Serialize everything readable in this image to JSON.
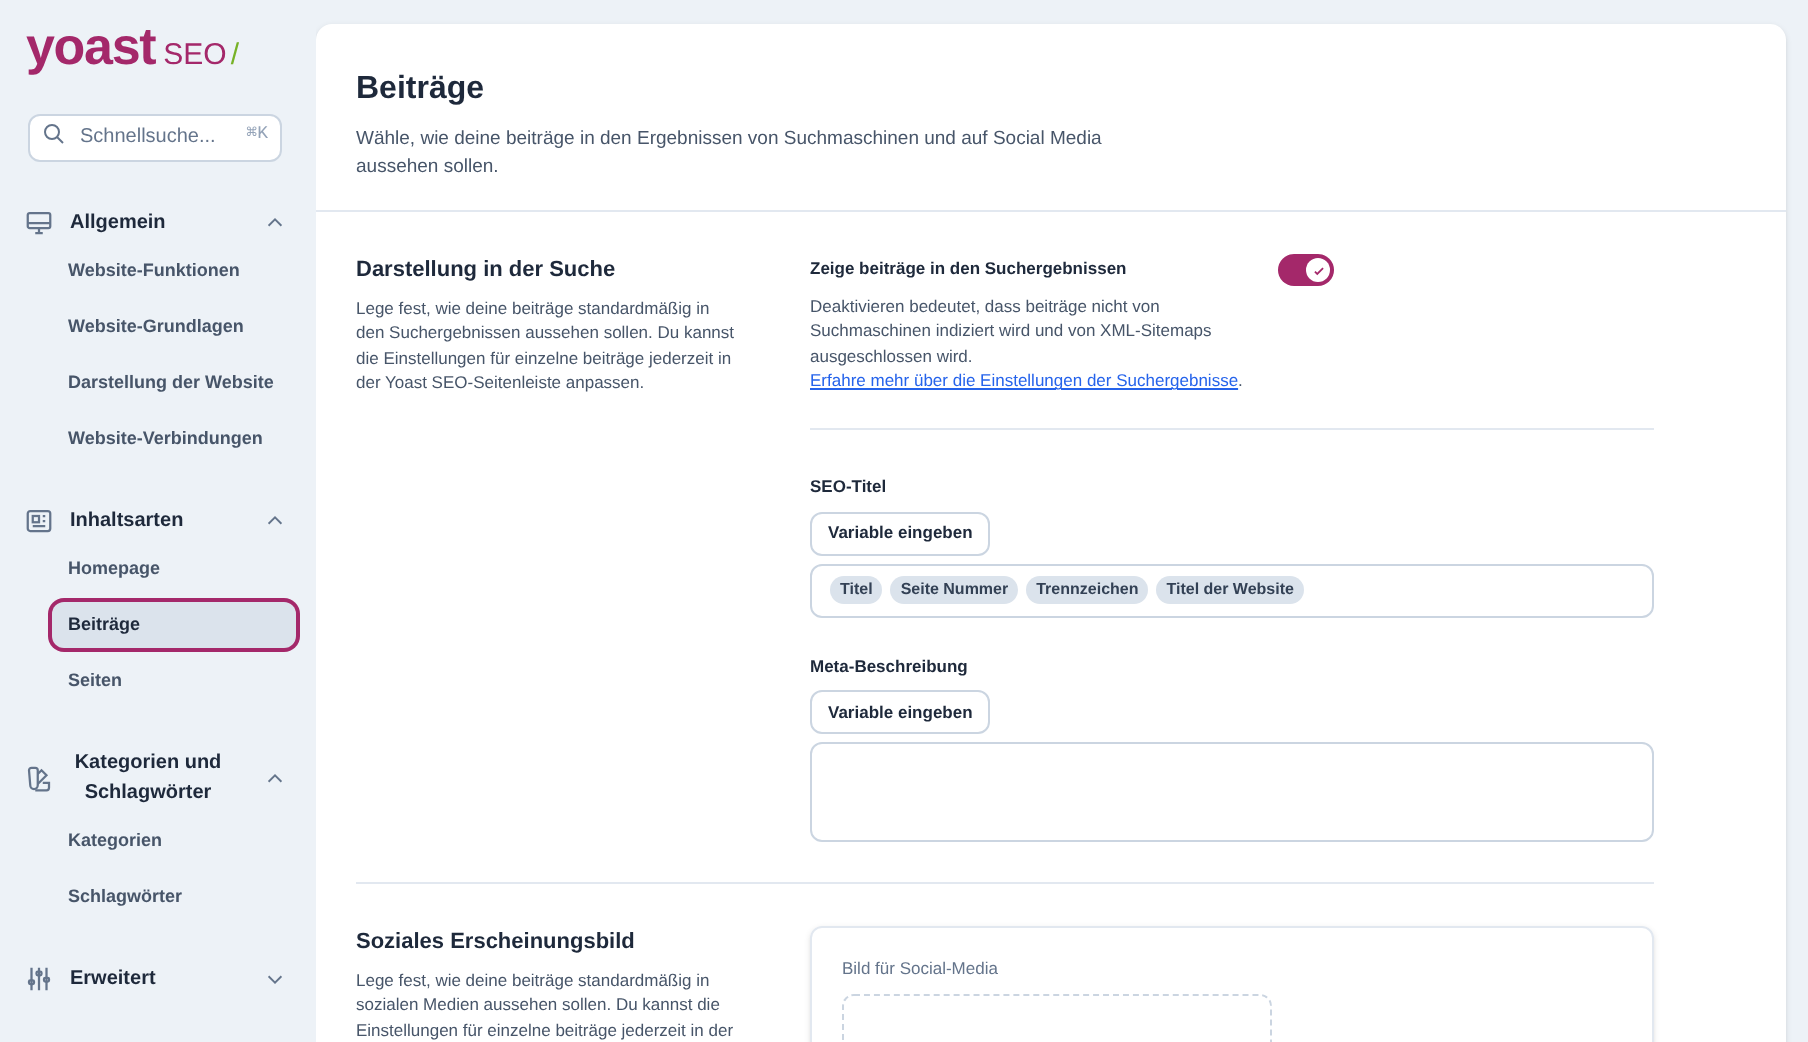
{
  "logo": {
    "brand": "yoast",
    "product": "SEO",
    "mark": "/"
  },
  "search": {
    "placeholder": "Schnellsuche...",
    "shortcut": "⌘K"
  },
  "sidebar": {
    "groups": [
      {
        "label": "Allgemein",
        "expanded": true,
        "items": [
          {
            "label": "Website-Funktionen",
            "selected": false
          },
          {
            "label": "Website-Grundlagen",
            "selected": false
          },
          {
            "label": "Darstellung der Website",
            "selected": false
          },
          {
            "label": "Website-Verbindungen",
            "selected": false
          }
        ]
      },
      {
        "label": "Inhaltsarten",
        "expanded": true,
        "items": [
          {
            "label": "Homepage",
            "selected": false
          },
          {
            "label": "Beiträge",
            "selected": true
          },
          {
            "label": "Seiten",
            "selected": false
          }
        ]
      },
      {
        "label": "Kategorien und Schlagwörter",
        "expanded": true,
        "items": [
          {
            "label": "Kategorien",
            "selected": false
          },
          {
            "label": "Schlagwörter",
            "selected": false
          }
        ]
      },
      {
        "label": "Erweitert",
        "expanded": false
      }
    ]
  },
  "page": {
    "title": "Beiträge",
    "description": "Wähle, wie deine beiträge in den Ergebnissen von Suchmaschinen und auf Social Media aussehen sollen."
  },
  "sections": [
    {
      "title": "Darstellung in der Suche",
      "description": "Lege fest, wie deine beiträge standardmäßig in den Suchergebnissen aussehen sollen. Du kannst die Einstellungen für einzelne beiträge jederzeit in der Yoast SEO-Seitenleiste anpassen.",
      "toggle": {
        "label": "Zeige beiträge in den Suchergebnissen",
        "on": true,
        "description": "Deaktivieren bedeutet, dass beiträge nicht von Suchmaschinen indiziert wird und von XML-Sitemaps ausgeschlossen wird. ",
        "link": "Erfahre mehr über die Einstellungen der Suchergebnisse",
        "after": "."
      },
      "fields": [
        {
          "label": "SEO-Titel",
          "button": "Variable eingeben",
          "kind": "tags",
          "tags": [
            "Titel",
            "Seite Nummer",
            "Trennzeichen",
            "Titel der Website"
          ]
        },
        {
          "label": "Meta-Beschreibung",
          "button": "Variable eingeben",
          "kind": "textarea"
        }
      ]
    },
    {
      "title": "Soziales Erscheinungsbild",
      "description": "Lege fest, wie deine beiträge standardmäßig in sozialen Medien aussehen sollen. Du kannst die Einstellungen für einzelne beiträge jederzeit in der",
      "image_card": {
        "label": "Bild für Social-Media"
      }
    }
  ]
}
